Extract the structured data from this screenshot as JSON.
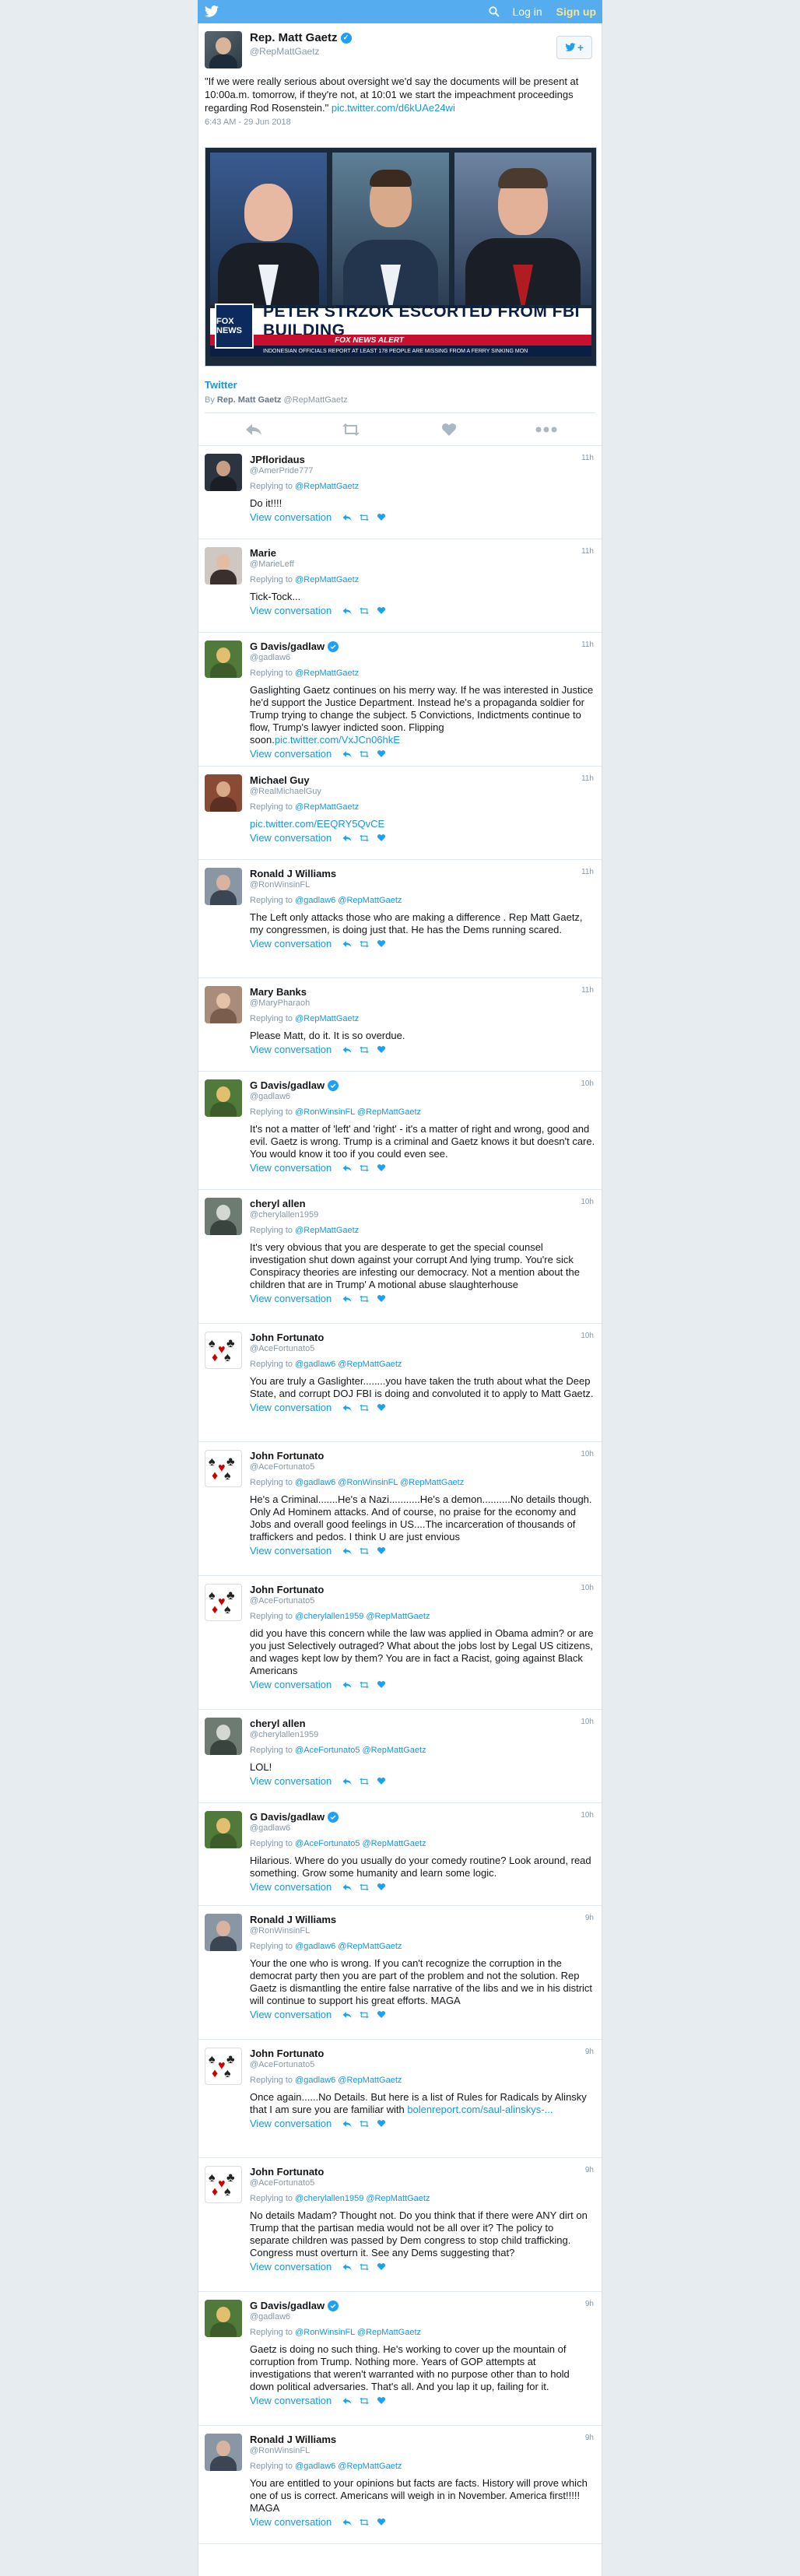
{
  "topbar": {
    "login": "Log in",
    "signup": "Sign up"
  },
  "tweet": {
    "author_name": "Rep. Matt Gaetz",
    "author_handle": "@RepMattGaetz",
    "follow_label": "+",
    "text": "\"If we were really serious about oversight we'd say the documents will be present at 10:00a.m. tomorrow, if they're not, at 10:01 we start the impeachment proceedings regarding Rod Rosenstein.\" ",
    "link": "pic.twitter.com/d6kUAe24wi",
    "timestamp": "6:43 AM - 29 Jun 2018",
    "media": {
      "network": "FOX NEWS",
      "headline": "PETER STRZOK ESCORTED FROM FBI BUILDING",
      "alert": "FOX NEWS ALERT",
      "ticker": "INDONESIAN OFFICIALS REPORT AT LEAST 178 PEOPLE ARE MISSING FROM A FERRY SINKING MON"
    },
    "source": "Twitter",
    "byline_prefix": "By",
    "byline_name": "Rep. Matt Gaetz",
    "byline_handle": "@RepMattGaetz"
  },
  "reply_common": {
    "replying_to": "Replying to",
    "view_conversation": "View conversation"
  },
  "replies": [
    {
      "name": "JPfloridaus",
      "handle": "@AmerPride777",
      "time": "11h",
      "to": "@RepMattGaetz",
      "text": "Do it!!!!"
    },
    {
      "name": "Marie",
      "handle": "@MarieLeff",
      "time": "11h",
      "to": "@RepMattGaetz",
      "text": "Tick-Tock..."
    },
    {
      "name": "G Davis/gadlaw",
      "handle": "@gadlaw6",
      "time": "11h",
      "to": "@RepMattGaetz",
      "text": "Gaslighting Gaetz continues on his merry way. If he was interested in Justice he'd support the Justice Department. Instead he's a propaganda soldier for Trump trying to change the subject. 5 Convictions, Indictments continue to flow, Trump's lawyer indicted soon. Flipping soon.",
      "link": "pic.twitter.com/VxJCn06hkE"
    },
    {
      "name": "Michael Guy",
      "handle": "@RealMichaelGuy",
      "time": "11h",
      "to": "@RepMattGaetz",
      "text": "",
      "link": "pic.twitter.com/EEQRY5QvCE"
    },
    {
      "name": "Ronald J Williams",
      "handle": "@RonWinsinFL",
      "time": "11h",
      "to": "@gadlaw6 @RepMattGaetz",
      "text": "The Left only attacks those who are making a difference . Rep Matt Gaetz, my congressmen, is doing just that. He has the Dems running scared."
    },
    {
      "name": "Mary Banks",
      "handle": "@MaryPharaoh",
      "time": "11h",
      "to": "@RepMattGaetz",
      "text": "Please Matt, do it. It is so overdue."
    },
    {
      "name": "G Davis/gadlaw",
      "handle": "@gadlaw6",
      "time": "10h",
      "to": "@RonWinsinFL @RepMattGaetz",
      "text": "It's not a matter of 'left' and 'right' - it's a matter of right and wrong, good and evil. Gaetz is wrong. Trump is a criminal and Gaetz knows it but doesn't care. You would know it too if you could even see."
    },
    {
      "name": "cheryl allen",
      "handle": "@cherylallen1959",
      "time": "10h",
      "to": "@RepMattGaetz",
      "text": "It's very obvious that you are desperate to get the special counsel investigation shut down against your corrupt And lying trump. You're sick Conspiracy theories are infesting our democracy. Not a mention about the children that are in Trump' A motional abuse slaughterhouse"
    },
    {
      "name": "John Fortunato",
      "handle": "@AceFortunato5",
      "time": "10h",
      "to": "@gadlaw6 @RepMattGaetz",
      "text": "You are truly a Gaslighter........you have taken the truth about what the Deep State, and corrupt DOJ FBI is doing and convoluted it to apply to Matt Gaetz."
    },
    {
      "name": "John Fortunato",
      "handle": "@AceFortunato5",
      "time": "10h",
      "to": "@gadlaw6 @RonWinsinFL @RepMattGaetz",
      "text": "He's a Criminal.......He's a Nazi...........He's a demon..........No details though. Only Ad Hominem attacks. And of course, no praise for the economy and Jobs and overall good feelings in US....The incarceration of thousands of traffickers and pedos. I think U are just envious"
    },
    {
      "name": "John Fortunato",
      "handle": "@AceFortunato5",
      "time": "10h",
      "to": "@cherylallen1959 @RepMattGaetz",
      "text": "did you have this concern while the law was applied in Obama admin? or are you just Selectively outraged? What about the jobs lost by Legal US citizens, and wages kept low by them? You are in fact a Racist, going against Black Americans"
    },
    {
      "name": "cheryl allen",
      "handle": "@cherylallen1959",
      "time": "10h",
      "to": "@AceFortunato5 @RepMattGaetz",
      "text": "LOL!"
    },
    {
      "name": "G Davis/gadlaw",
      "handle": "@gadlaw6",
      "time": "10h",
      "to": "@AceFortunato5 @RepMattGaetz",
      "text": "Hilarious. Where do you usually do your comedy routine? Look around, read something. Grow some humanity and learn some logic."
    },
    {
      "name": "Ronald J Williams",
      "handle": "@RonWinsinFL",
      "time": "9h",
      "to": "@gadlaw6 @RepMattGaetz",
      "text": "Your the one who is wrong. If you can't recognize the corruption in the democrat party then you are part of the problem and not the solution. Rep Gaetz is dismantling the entire false narrative of the libs and we in his district will continue to support his great efforts. MAGA"
    },
    {
      "name": "John Fortunato",
      "handle": "@AceFortunato5",
      "time": "9h",
      "to": "@gadlaw6 @RepMattGaetz",
      "text": "Once again......No Details. But here is a list of Rules for Radicals by Alinsky that I am sure you are familiar with ",
      "link": "bolenreport.com/saul-alinskys-..."
    },
    {
      "name": "John Fortunato",
      "handle": "@AceFortunato5",
      "time": "9h",
      "to": "@cherylallen1959 @RepMattGaetz",
      "text": "No details Madam? Thought not. Do you think that if there were ANY dirt on Trump that the partisan media would not be all over it? The policy to separate children was passed by Dem congress to stop child trafficking. Congress must overturn it. See any Dems suggesting that?"
    },
    {
      "name": "G Davis/gadlaw",
      "handle": "@gadlaw6",
      "time": "9h",
      "to": "@RonWinsinFL @RepMattGaetz",
      "text": "Gaetz is doing no such thing. He's working to cover up the mountain of corruption from Trump. Nothing more. Years of GOP attempts at investigations that weren't warranted with no purpose other than to hold down political adversaries. That's all. And you lap it up, failing for it."
    },
    {
      "name": "Ronald J Williams",
      "handle": "@RonWinsinFL",
      "time": "9h",
      "to": "@gadlaw6 @RepMattGaetz",
      "text": "You are entitled to your opinions but facts are facts. History will prove which one of us is correct. Americans will weigh in in November. America first!!!!! MAGA"
    }
  ]
}
